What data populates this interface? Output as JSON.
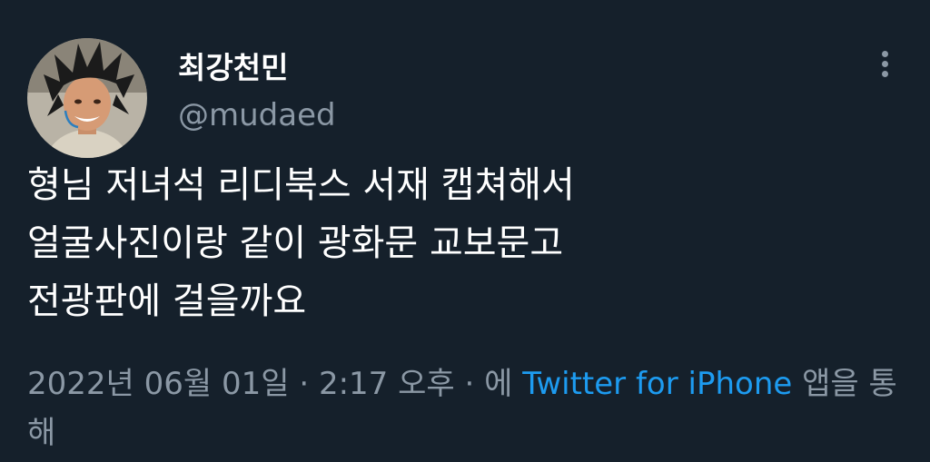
{
  "user": {
    "display_name": "최강천민",
    "handle": "@mudaed"
  },
  "tweet": {
    "lines": [
      "형님 저녀석 리디북스 서재 캡쳐해서",
      "얼굴사진이랑 같이 광화문 교보문고",
      "전광판에 걸을까요"
    ]
  },
  "meta": {
    "date": "2022년 06월 01일",
    "separator": " · ",
    "time": "2:17 오후",
    "via_prefix": "에 ",
    "source": "Twitter for iPhone",
    "via_suffix": " 앱을 통해"
  },
  "icons": {
    "more": "more-vertical-icon"
  },
  "colors": {
    "background": "#15202b",
    "text": "#ffffff",
    "secondary": "#8b98a5",
    "link": "#1d9bf0"
  }
}
